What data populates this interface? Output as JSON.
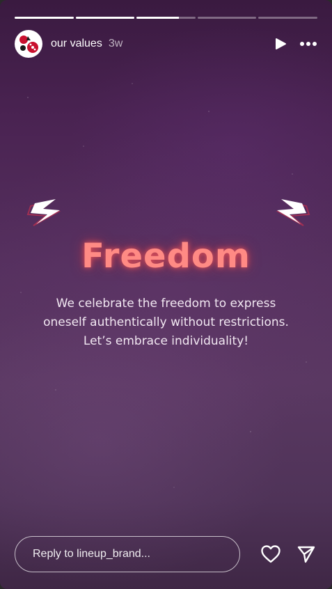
{
  "story": {
    "title": "our values",
    "time_ago": "3w",
    "segments": [
      1,
      1,
      0.72,
      0,
      0
    ]
  },
  "header": {
    "avatar_icon": "brand-avatar-icon",
    "play_icon": "play-icon",
    "more_icon": "more-options-icon"
  },
  "content": {
    "headline": "Freedom",
    "body_lines": [
      "We celebrate the freedom to express",
      "oneself authentically without restrictions.",
      "Let’s embrace individuality!"
    ],
    "headline_color": "#ff8a84",
    "background_color": "#4a2352"
  },
  "footer": {
    "reply_placeholder": "Reply to lineup_brand...",
    "like_icon": "heart-icon",
    "send_icon": "send-icon"
  }
}
